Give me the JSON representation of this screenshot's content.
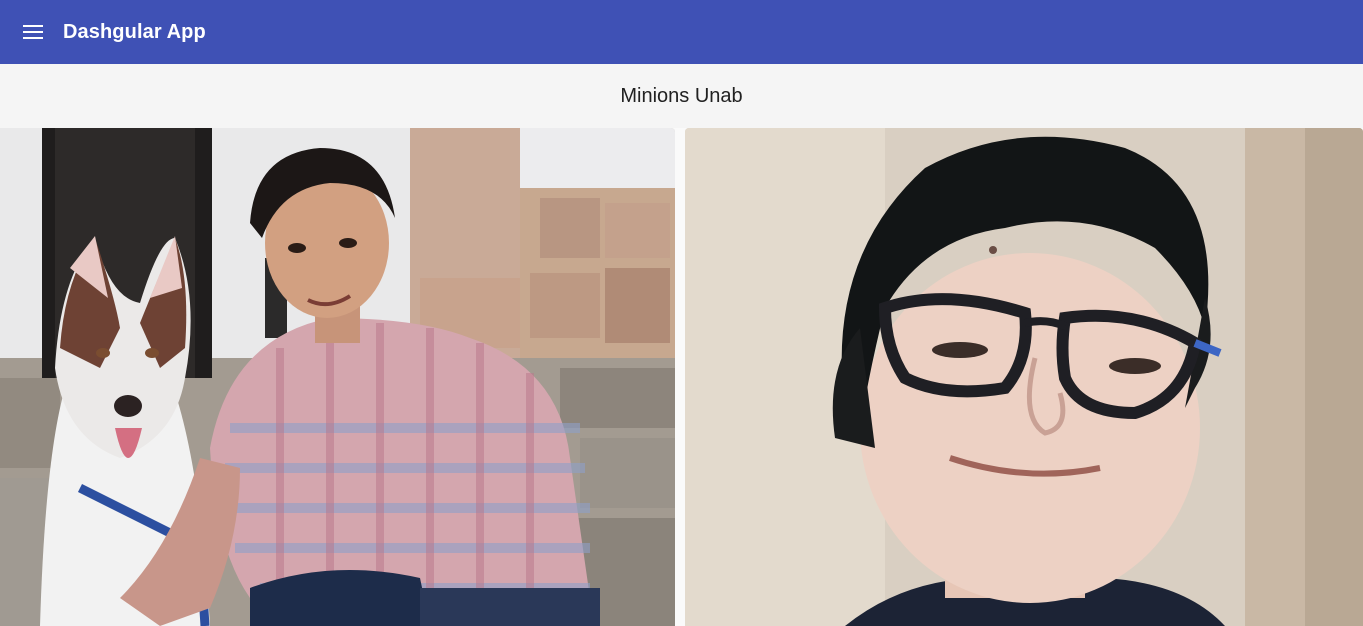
{
  "toolbar": {
    "menu_icon": "menu-icon",
    "title": "Dashgular App",
    "color": "#3f51b5"
  },
  "main": {
    "title": "Minions Unab",
    "cards": [
      {
        "image": "photo of young man in plaid shirt with husky dog"
      },
      {
        "image": "photo of smiling person with glasses"
      }
    ]
  }
}
